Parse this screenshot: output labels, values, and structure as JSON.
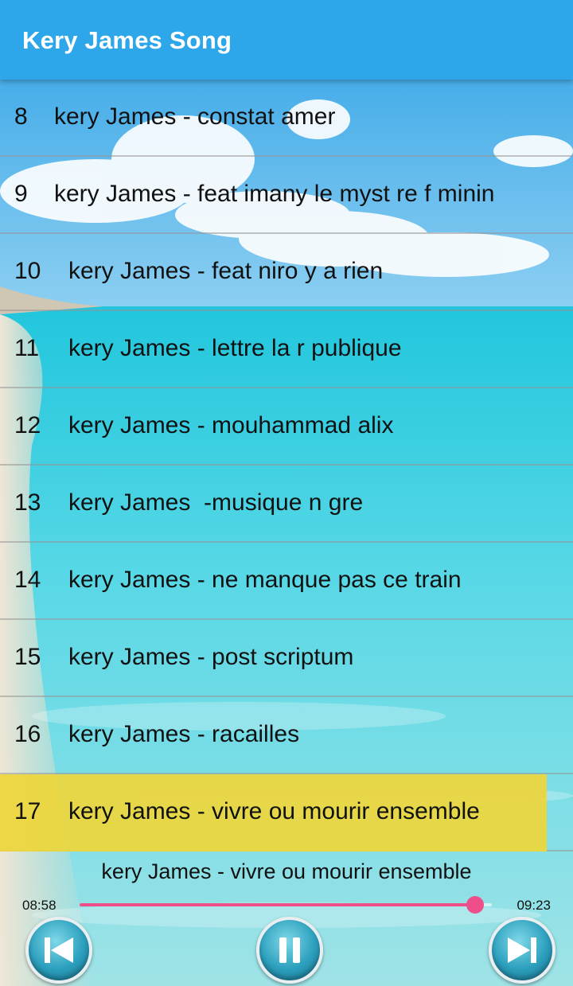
{
  "app": {
    "title": "Kery James Song"
  },
  "songs": [
    {
      "number": "8",
      "title": "kery James - constat amer"
    },
    {
      "number": "9",
      "title": "kery James - feat imany le myst re f minin"
    },
    {
      "number": "10",
      "title": "kery James - feat niro y a rien"
    },
    {
      "number": "11",
      "title": "kery James - lettre la r publique"
    },
    {
      "number": "12",
      "title": "kery James - mouhammad alix"
    },
    {
      "number": "13",
      "title": "kery James  -musique n gre"
    },
    {
      "number": "14",
      "title": "kery James - ne manque pas ce train"
    },
    {
      "number": "15",
      "title": "kery James - post scriptum"
    },
    {
      "number": "16",
      "title": "kery James - racailles"
    },
    {
      "number": "17",
      "title": "kery James - vivre ou mourir ensemble"
    }
  ],
  "player": {
    "now_playing": "kery James - vivre ou mourir ensemble",
    "elapsed": "08:58",
    "duration": "09:23",
    "progress": 0.96
  },
  "icons": {
    "prev": "skip-previous-icon",
    "pause": "pause-icon",
    "next": "skip-next-icon"
  },
  "colors": {
    "appbar": "#2ea6ea",
    "highlight": "#eed63a",
    "seek_accent": "#ee4f8b"
  }
}
